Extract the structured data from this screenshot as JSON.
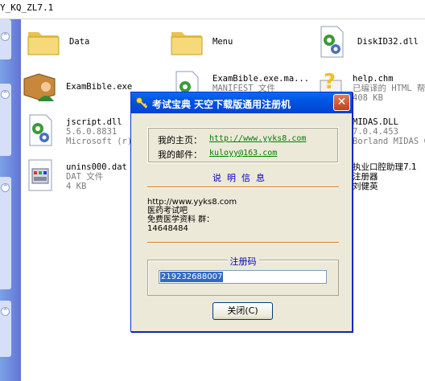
{
  "window": {
    "path": "Y_KQ_ZL7.1"
  },
  "files": [
    {
      "name": "Data",
      "icon": "folder-icon"
    },
    {
      "name": "Menu",
      "icon": "folder-icon"
    },
    {
      "name": "DiskID32.dll",
      "icon": "dll-gear-icon"
    },
    {
      "name": "ExamBible.exe",
      "icon": "app-person-icon"
    },
    {
      "name": "ExamBible.exe.ma...",
      "sub1": "MANIFEST 文件",
      "icon": "manifest-icon"
    },
    {
      "name": "help.chm",
      "sub1": "已编译的 HTML 帮",
      "sub2": "408 KB",
      "icon": "chm-help-icon"
    },
    {
      "name": "jscript.dll",
      "sub1": "5.6.0.8831",
      "sub2": "Microsoft (r)",
      "icon": "dll-gear-icon"
    },
    {
      "name": "MIDAS.DLL",
      "sub1": "7.0.4.453",
      "sub2": "Borland MIDAS C",
      "icon": "dll-gear-icon"
    },
    {
      "name": "unins000.dat",
      "sub1": "DAT 文件",
      "sub2": "4 KB",
      "icon": "dat-file-icon"
    },
    {
      "name": "执业口腔助理7.1",
      "sub1": "注册器",
      "sub2": "刘健英",
      "icon": "app-icon"
    }
  ],
  "dialog": {
    "title": "考试宝典 天空下载版通用注册机",
    "homepage_label": "我的主页：",
    "homepage_url": "http://www.yyks8.com",
    "email_label": "我的邮件：",
    "email": "kuloyy@163.com",
    "section_title": "说明信息",
    "info": "http://www.yyks8.com\n医药考试吧\n免费医学资料 群：\n14648484",
    "reg_caption": "注册码",
    "reg_code": "219232688007",
    "close_label": "关闭(C)"
  },
  "colors": {
    "dialog_title": "#0054e3",
    "link": "#008000",
    "accent_text": "#0000c0",
    "selection": "#316ac5"
  }
}
